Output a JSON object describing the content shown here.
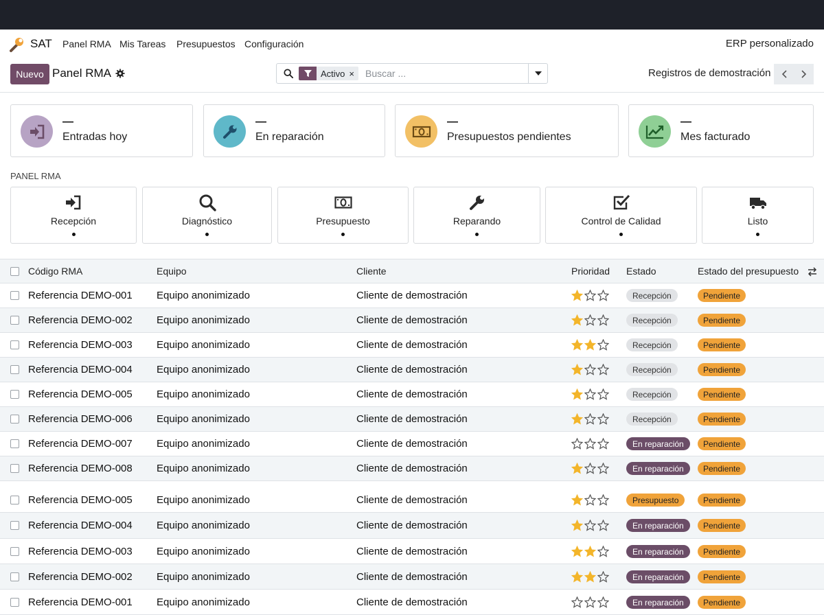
{
  "navbar": {
    "app_name": "SAT",
    "menu": [
      "Panel RMA",
      "Mis Tareas",
      "Presupuestos",
      "Configuración"
    ],
    "company": "ERP personalizado"
  },
  "control_panel": {
    "new_label": "Nuevo",
    "breadcrumb": "Panel RMA",
    "facet": "Activo",
    "facet_remove": "×",
    "search_placeholder": "Buscar ...",
    "demo_label": "Registros de demostración"
  },
  "kpis": [
    {
      "value": "—",
      "label": "Entradas hoy",
      "icon": "sign-in-icon",
      "color": "#b7a3c4"
    },
    {
      "value": "—",
      "label": "En reparación",
      "icon": "wrench-icon",
      "color": "#5fb8c9"
    },
    {
      "value": "—",
      "label": "Presupuestos pendientes",
      "icon": "money-icon",
      "color": "#f2c065"
    },
    {
      "value": "—",
      "label": "Mes facturado",
      "icon": "chart-line-icon",
      "color": "#8fcf95"
    }
  ],
  "panel": {
    "title": "PANEL RMA",
    "stages": [
      {
        "label": "Recepción",
        "icon": "sign-in-icon"
      },
      {
        "label": "Diagnóstico",
        "icon": "search-icon"
      },
      {
        "label": "Presupuesto",
        "icon": "money-icon"
      },
      {
        "label": "Reparando",
        "icon": "wrench-icon"
      },
      {
        "label": "Control de Calidad",
        "icon": "check-square-icon"
      },
      {
        "label": "Listo",
        "icon": "truck-icon"
      }
    ]
  },
  "list": {
    "columns": [
      "Código RMA",
      "Equipo",
      "Cliente",
      "Prioridad",
      "Estado",
      "Estado del presupuesto"
    ],
    "rows": [
      {
        "code": "Referencia DEMO-001",
        "equipo": "Equipo anonimizado",
        "cliente": "Cliente de demostración",
        "priority": 1,
        "estado": "Recepción",
        "presupuesto": "Pendiente"
      },
      {
        "code": "Referencia DEMO-002",
        "equipo": "Equipo anonimizado",
        "cliente": "Cliente de demostración",
        "priority": 1,
        "estado": "Recepción",
        "presupuesto": "Pendiente"
      },
      {
        "code": "Referencia DEMO-003",
        "equipo": "Equipo anonimizado",
        "cliente": "Cliente de demostración",
        "priority": 2,
        "estado": "Recepción",
        "presupuesto": "Pendiente"
      },
      {
        "code": "Referencia DEMO-004",
        "equipo": "Equipo anonimizado",
        "cliente": "Cliente de demostración",
        "priority": 1,
        "estado": "Recepción",
        "presupuesto": "Pendiente"
      },
      {
        "code": "Referencia DEMO-005",
        "equipo": "Equipo anonimizado",
        "cliente": "Cliente de demostración",
        "priority": 1,
        "estado": "Recepción",
        "presupuesto": "Pendiente"
      },
      {
        "code": "Referencia DEMO-006",
        "equipo": "Equipo anonimizado",
        "cliente": "Cliente de demostración",
        "priority": 1,
        "estado": "Recepción",
        "presupuesto": "Pendiente"
      },
      {
        "code": "Referencia DEMO-007",
        "equipo": "Equipo anonimizado",
        "cliente": "Cliente de demostración",
        "priority": 0,
        "estado": "En reparación",
        "presupuesto": "Pendiente"
      },
      {
        "code": "Referencia DEMO-008",
        "equipo": "Equipo anonimizado",
        "cliente": "Cliente de demostración",
        "priority": 1,
        "estado": "En reparación",
        "presupuesto": "Pendiente"
      },
      {
        "code": "Referencia DEMO-005",
        "equipo": "Equipo anonimizado",
        "cliente": "Cliente de demostración",
        "priority": 1,
        "estado": "Presupuesto",
        "presupuesto": "Pendiente"
      },
      {
        "code": "Referencia DEMO-004",
        "equipo": "Equipo anonimizado",
        "cliente": "Cliente de demostración",
        "priority": 1,
        "estado": "En reparación",
        "presupuesto": "Pendiente"
      },
      {
        "code": "Referencia DEMO-003",
        "equipo": "Equipo anonimizado",
        "cliente": "Cliente de demostración",
        "priority": 2,
        "estado": "En reparación",
        "presupuesto": "Pendiente"
      },
      {
        "code": "Referencia DEMO-002",
        "equipo": "Equipo anonimizado",
        "cliente": "Cliente de demostración",
        "priority": 2,
        "estado": "En reparación",
        "presupuesto": "Pendiente"
      },
      {
        "code": "Referencia DEMO-001",
        "equipo": "Equipo anonimizado",
        "cliente": "Cliente de demostración",
        "priority": 0,
        "estado": "En reparación",
        "presupuesto": "Pendiente"
      }
    ]
  },
  "colors": {
    "brand": "#714b67",
    "badge_recepcion": "#e1e3e6",
    "badge_reparacion": "#6b4d67",
    "badge_presupuesto": "#f0a33a",
    "badge_pendiente": "#f0a33a",
    "star": "#f3b52a"
  }
}
